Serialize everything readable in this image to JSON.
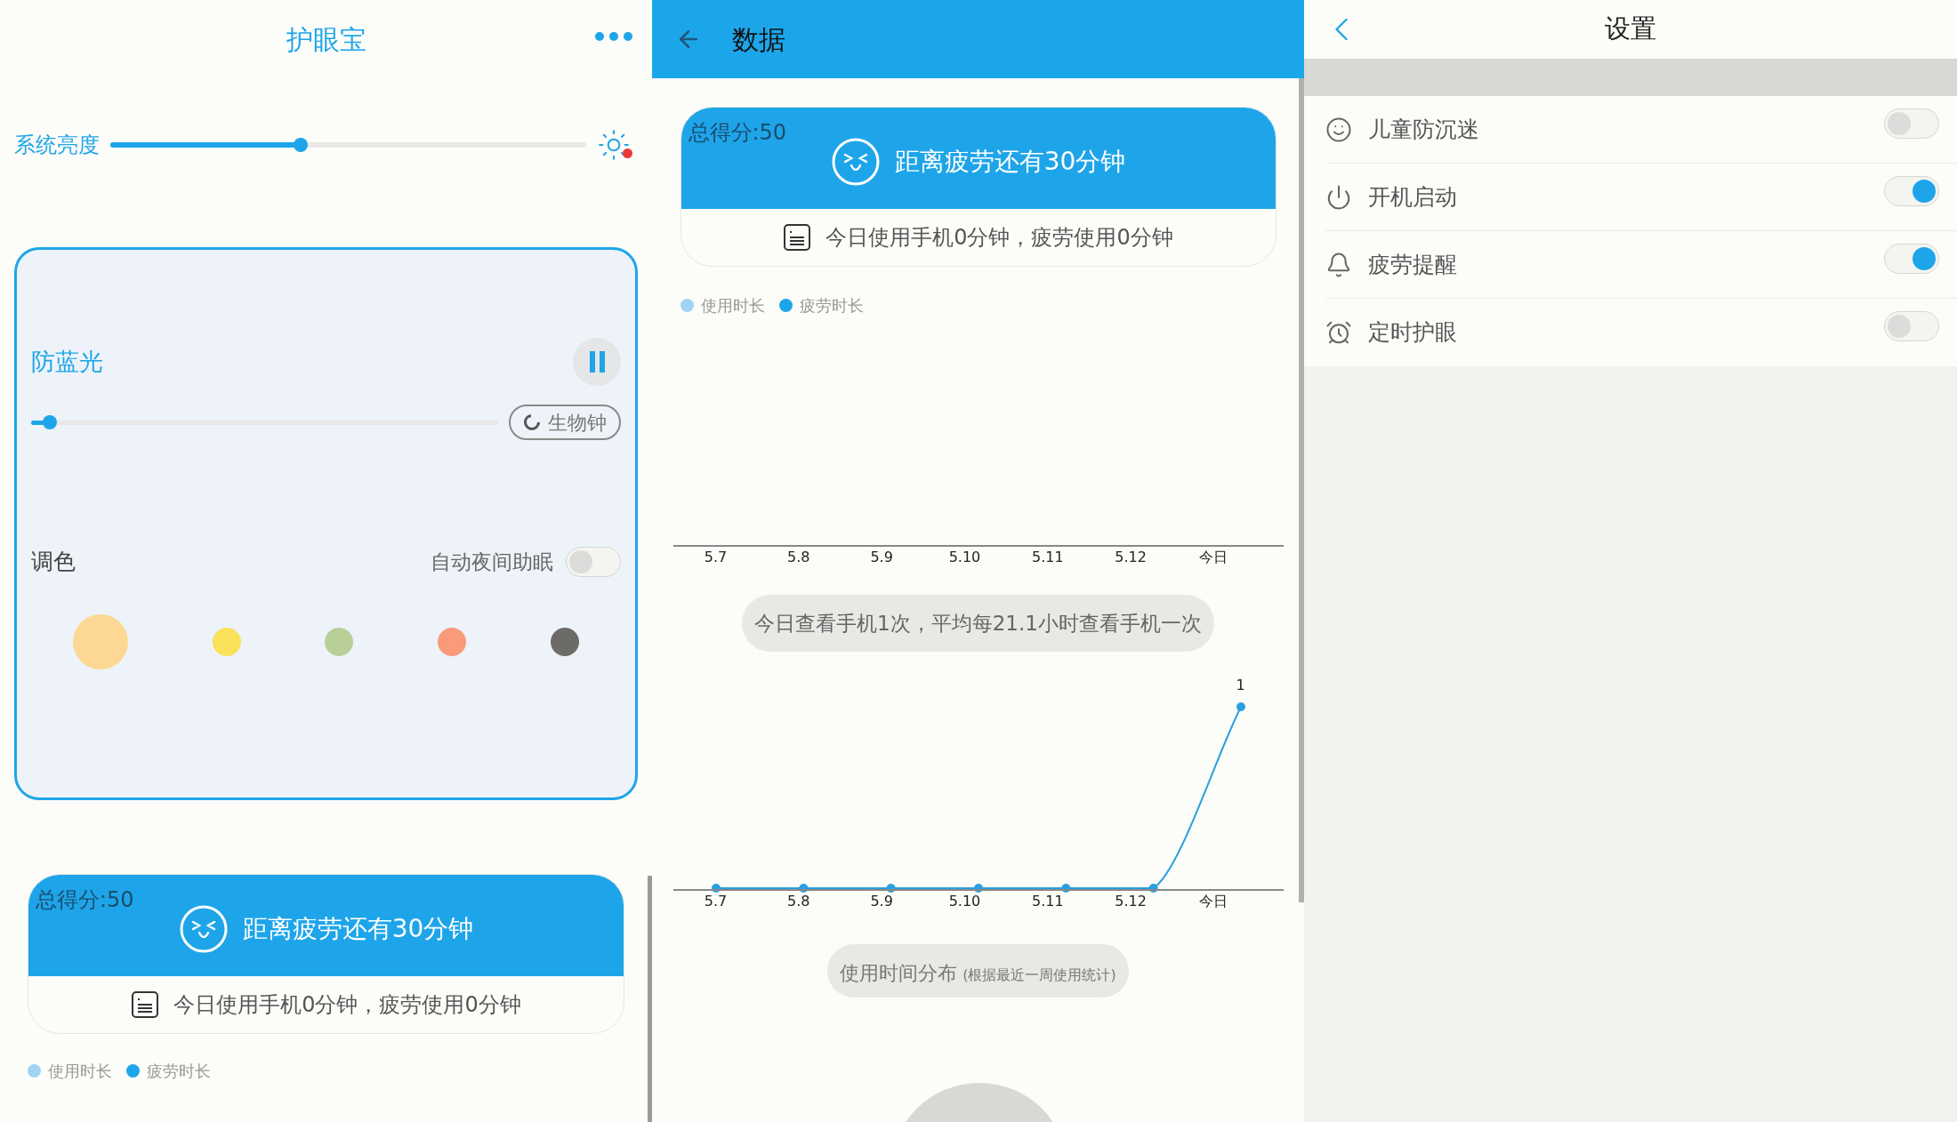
{
  "home": {
    "title": "护眼宝",
    "brightness": {
      "label": "系统亮度",
      "level": 0.4
    },
    "blue_light": {
      "title": "防蓝光",
      "level": 0.04,
      "bio_clock": "生物钟"
    },
    "tint": {
      "label": "调色",
      "auto_night": {
        "label": "自动夜间助眠",
        "on": false
      },
      "swatches": [
        {
          "color": "#fcd894",
          "selected": true
        },
        {
          "color": "#f9e15a",
          "selected": false
        },
        {
          "color": "#b8cf98",
          "selected": false
        },
        {
          "color": "#f99a7a",
          "selected": false
        },
        {
          "color": "#6d6b68",
          "selected": false
        }
      ]
    },
    "score_card": {
      "score": "总得分:50",
      "message": "距离疲劳还有30分钟",
      "usage": "今日使用手机0分钟，疲劳使用0分钟"
    },
    "legend": [
      {
        "label": "使用时长",
        "color": "#9fd4f2"
      },
      {
        "label": "疲劳时长",
        "color": "#1ea5e9"
      }
    ]
  },
  "data": {
    "title": "数据",
    "score_card": {
      "score": "总得分:50",
      "message": "距离疲劳还有30分钟",
      "usage": "今日使用手机0分钟，疲劳使用0分钟"
    },
    "legend": [
      {
        "label": "使用时长",
        "color": "#9fd4f2"
      },
      {
        "label": "疲劳时长",
        "color": "#1ea5e9"
      }
    ],
    "usage_chart": {
      "axis_labels": [
        "5.7",
        "5.8",
        "5.9",
        "5.10",
        "5.11",
        "5.12",
        "今日"
      ]
    },
    "checks_summary": "今日查看手机1次，平均每21.1小时查看手机一次",
    "checks_chart": {
      "axis_labels": [
        "5.7",
        "5.8",
        "5.9",
        "5.10",
        "5.11",
        "5.12",
        "今日"
      ],
      "peak_label": "1"
    },
    "distribution": {
      "title": "使用时间分布",
      "note": "(根据最近一周使用统计)"
    }
  },
  "settings": {
    "title": "设置",
    "items": [
      {
        "kind": "child",
        "label": "儿童防沉迷",
        "on": false
      },
      {
        "kind": "power",
        "label": "开机启动",
        "on": true
      },
      {
        "kind": "bell",
        "label": "疲劳提醒",
        "on": true
      },
      {
        "kind": "alarm",
        "label": "定时护眼",
        "on": false
      }
    ]
  }
}
